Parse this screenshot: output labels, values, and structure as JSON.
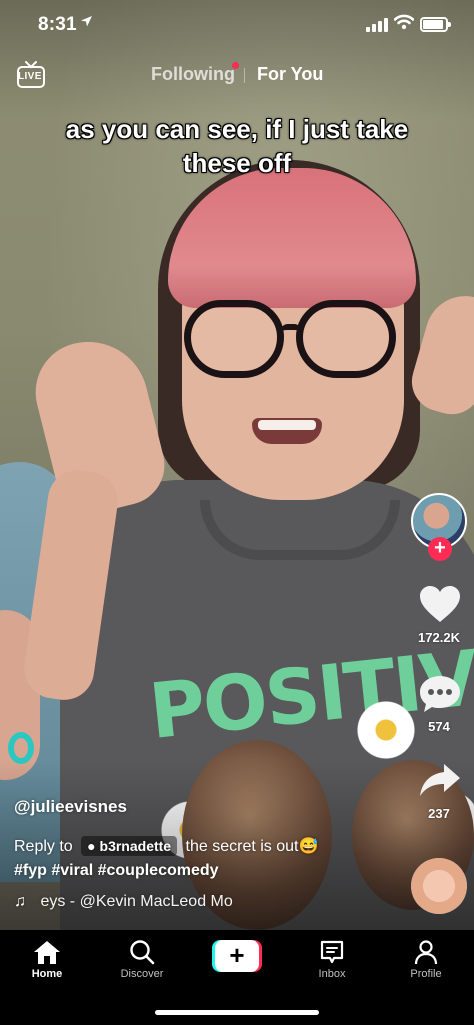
{
  "status_bar": {
    "time": "8:31",
    "location_icon": "location-arrow-icon"
  },
  "top_nav": {
    "live_label": "LIVE",
    "tabs": [
      {
        "label": "Following",
        "active": false
      },
      {
        "label": "For You",
        "active": true
      }
    ]
  },
  "video": {
    "caption": "as you can see, if I just take these off",
    "shirt_print": "POSITIVE"
  },
  "rail": {
    "likes": "172.2K",
    "comments": "574",
    "shares": "237"
  },
  "post": {
    "username": "@julieevisnes",
    "reply_prefix": "Reply to",
    "reply_user": "b3rnadette",
    "reply_text": "the secret is out😅",
    "hashtags": "#fyp #viral #couplecomedy",
    "music": "eys - @Kevin MacLeod    Mo"
  },
  "tabbar": {
    "items": [
      {
        "label": "Home",
        "icon": "home-icon",
        "active": true
      },
      {
        "label": "Discover",
        "icon": "search-icon",
        "active": false
      },
      {
        "label": "",
        "icon": "create-plus-icon",
        "active": false
      },
      {
        "label": "Inbox",
        "icon": "inbox-icon",
        "active": false
      },
      {
        "label": "Profile",
        "icon": "profile-icon",
        "active": false
      }
    ]
  },
  "colors": {
    "accent_red": "#fe2c55",
    "accent_cyan": "#25f4ee"
  }
}
